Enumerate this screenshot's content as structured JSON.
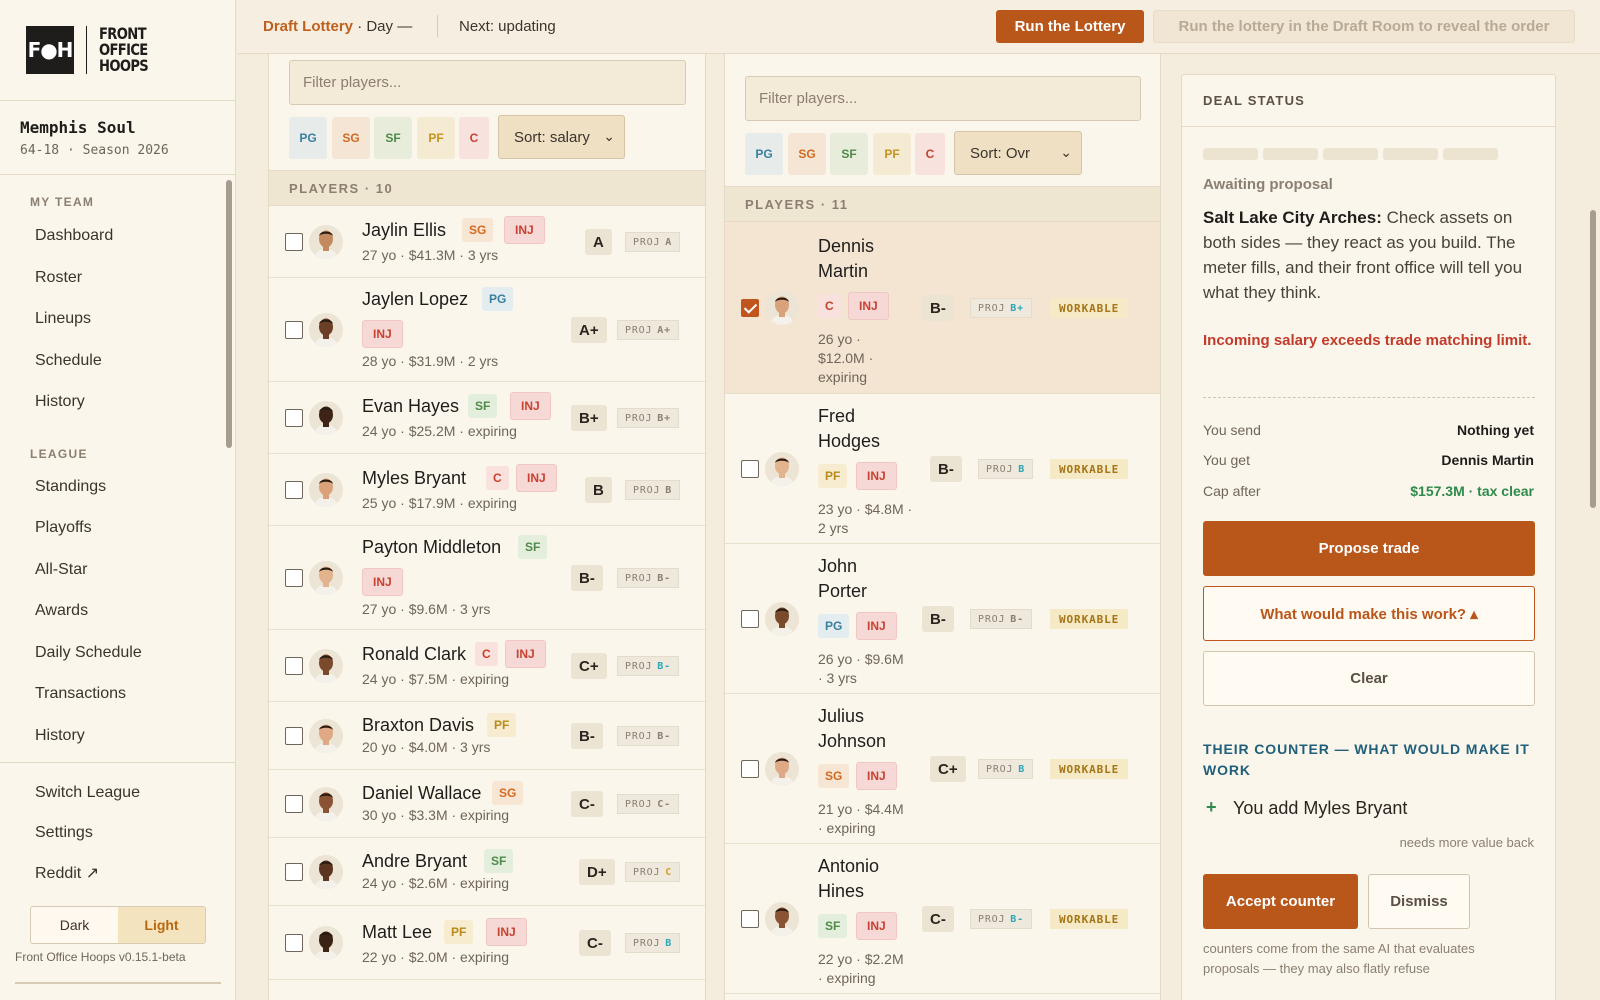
{
  "brand": {
    "logo_mark": "F●H",
    "logo_lines": [
      "FRONT",
      "OFFICE",
      "HOOPS"
    ]
  },
  "team": {
    "name": "Memphis Soul",
    "record_season": "64-18 · Season 2026"
  },
  "sidebar": {
    "my_team_label": "MY TEAM",
    "my_team_items": [
      "Dashboard",
      "Roster",
      "Lineups",
      "Schedule",
      "History"
    ],
    "league_label": "LEAGUE",
    "league_items": [
      "Standings",
      "Playoffs",
      "All-Star",
      "Awards",
      "Daily Schedule",
      "Transactions",
      "History"
    ],
    "footer_items": [
      "Switch League",
      "Settings",
      "Reddit ↗"
    ],
    "theme": {
      "dark": "Dark",
      "light": "Light",
      "selected": "Light"
    },
    "version": "Front Office Hoops v0.15.1-beta"
  },
  "topbar": {
    "title": "Draft Lottery",
    "title_suffix": "· Day —",
    "next": "Next: updating",
    "run_button": "Run the Lottery",
    "hint": "Run the lottery in the Draft Room to reveal the order"
  },
  "left_panel": {
    "filter_placeholder": "Filter players...",
    "positions": [
      "PG",
      "SG",
      "SF",
      "PF",
      "C"
    ],
    "sort": "Sort: salary",
    "header": "PLAYERS · 10",
    "players": [
      {
        "name": "Jaylin Ellis",
        "pos": "SG",
        "inj": "INJ",
        "meta": "27 yo · $41.3M · 3 yrs",
        "grade": "A",
        "proj_label": "PROJ",
        "proj": "A",
        "proj_trend": "same"
      },
      {
        "name": "Jaylen Lopez",
        "pos": "PG",
        "inj": "INJ",
        "meta": "28 yo · $31.9M · 2 yrs",
        "grade": "A+",
        "proj_label": "PROJ",
        "proj": "A+",
        "proj_trend": "same"
      },
      {
        "name": "Evan Hayes",
        "pos": "SF",
        "inj": "INJ",
        "meta": "24 yo · $25.2M · expiring",
        "grade": "B+",
        "proj_label": "PROJ",
        "proj": "B+",
        "proj_trend": "same"
      },
      {
        "name": "Myles Bryant",
        "pos": "C",
        "inj": "INJ",
        "meta": "25 yo · $17.9M · expiring",
        "grade": "B",
        "proj_label": "PROJ",
        "proj": "B",
        "proj_trend": "same"
      },
      {
        "name": "Payton Middleton",
        "pos": "SF",
        "inj": "INJ",
        "meta": "27 yo · $9.6M · 3 yrs",
        "grade": "B-",
        "proj_label": "PROJ",
        "proj": "B-",
        "proj_trend": "same"
      },
      {
        "name": "Ronald Clark",
        "pos": "C",
        "inj": "INJ",
        "meta": "24 yo · $7.5M · expiring",
        "grade": "C+",
        "proj_label": "PROJ",
        "proj": "B-",
        "proj_trend": "up"
      },
      {
        "name": "Braxton Davis",
        "pos": "PF",
        "inj": "",
        "meta": "20 yo · $4.0M · 3 yrs",
        "grade": "B-",
        "proj_label": "PROJ",
        "proj": "B-",
        "proj_trend": "same"
      },
      {
        "name": "Daniel Wallace",
        "pos": "SG",
        "inj": "",
        "meta": "30 yo · $3.3M · expiring",
        "grade": "C-",
        "proj_label": "PROJ",
        "proj": "C-",
        "proj_trend": "same"
      },
      {
        "name": "Andre Bryant",
        "pos": "SF",
        "inj": "",
        "meta": "24 yo · $2.6M · expiring",
        "grade": "D+",
        "proj_label": "PROJ",
        "proj": "C",
        "proj_trend": "warn"
      },
      {
        "name": "Matt Lee",
        "pos": "PF",
        "inj": "INJ",
        "meta": "22 yo · $2.0M · expiring",
        "grade": "C-",
        "proj_label": "PROJ",
        "proj": "B",
        "proj_trend": "up"
      }
    ]
  },
  "right_panel": {
    "filter_placeholder": "Filter players...",
    "positions": [
      "PG",
      "SG",
      "SF",
      "PF",
      "C"
    ],
    "sort": "Sort: Ovr",
    "header": "PLAYERS · 11",
    "players": [
      {
        "name_lines": [
          "Dennis",
          "Martin"
        ],
        "pos": "C",
        "inj": "INJ",
        "meta_lines": [
          "26 yo ·",
          "$12.0M ·",
          "expiring"
        ],
        "grade": "B-",
        "proj_label": "PROJ",
        "proj": "B+",
        "proj_trend": "up",
        "status": "WORKABLE",
        "checked": true
      },
      {
        "name_lines": [
          "Fred",
          "Hodges"
        ],
        "pos": "PF",
        "inj": "INJ",
        "meta_lines": [
          "23 yo · $4.8M ·",
          "2 yrs"
        ],
        "grade": "B-",
        "proj_label": "PROJ",
        "proj": "B",
        "proj_trend": "up",
        "status": "WORKABLE",
        "checked": false
      },
      {
        "name_lines": [
          "John",
          "Porter"
        ],
        "pos": "PG",
        "inj": "INJ",
        "meta_lines": [
          "26 yo · $9.6M",
          "· 3 yrs"
        ],
        "grade": "B-",
        "proj_label": "PROJ",
        "proj": "B-",
        "proj_trend": "same",
        "status": "WORKABLE",
        "checked": false
      },
      {
        "name_lines": [
          "Julius",
          "Johnson"
        ],
        "pos": "SG",
        "inj": "INJ",
        "meta_lines": [
          "21 yo · $4.4M",
          "· expiring"
        ],
        "grade": "C+",
        "proj_label": "PROJ",
        "proj": "B",
        "proj_trend": "up",
        "status": "WORKABLE",
        "checked": false
      },
      {
        "name_lines": [
          "Antonio",
          "Hines"
        ],
        "pos": "SF",
        "inj": "INJ",
        "meta_lines": [
          "22 yo · $2.2M",
          "· expiring"
        ],
        "grade": "C-",
        "proj_label": "PROJ",
        "proj": "B-",
        "proj_trend": "up",
        "status": "WORKABLE",
        "checked": false
      }
    ]
  },
  "deal": {
    "header": "DEAL STATUS",
    "meter_fill": 0,
    "awaiting": "Awaiting proposal",
    "partner": "Salt Lake City Arches:",
    "message": "Check assets on both sides — they react as you build. The meter fills, and their front office will tell you what they think.",
    "error": "Incoming salary exceeds trade matching limit.",
    "you_send_label": "You send",
    "you_send": "Nothing yet",
    "you_get_label": "You get",
    "you_get": "Dennis Martin",
    "cap_after_label": "Cap after",
    "cap_after": "$157.3M · tax clear",
    "propose": "Propose trade",
    "what": "What would make this work? ▴",
    "clear": "Clear",
    "counter_title": "THEIR COUNTER — WHAT WOULD MAKE IT WORK",
    "counter_item": "You add Myles Bryant",
    "counter_note": "needs more value back",
    "accept": "Accept counter",
    "dismiss": "Dismiss",
    "footnote": "counters come from the same AI that evaluates proposals — they may also flatly refuse"
  },
  "colors": {
    "accent": "#b9561a",
    "error": "#c23a2a",
    "positive": "#2d8a4a",
    "counter": "#1f5f7a"
  }
}
